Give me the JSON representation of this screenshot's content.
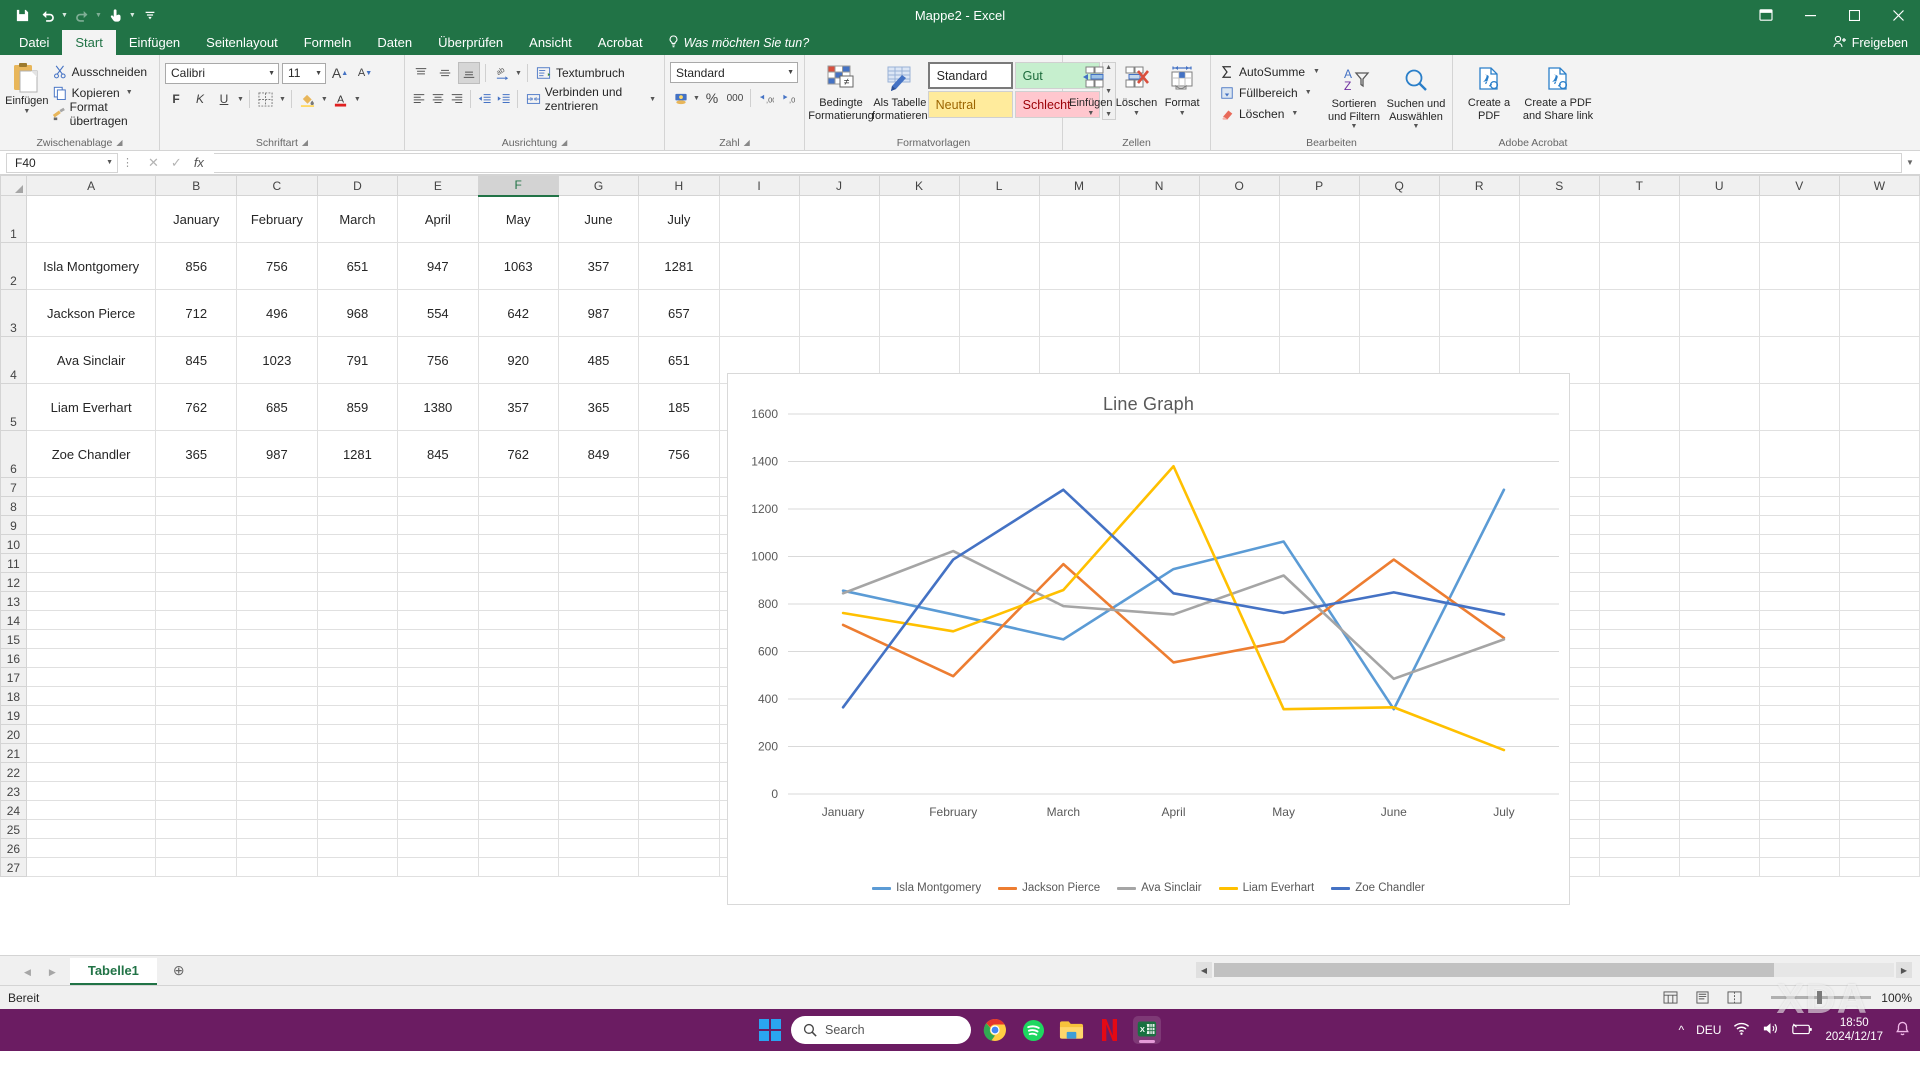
{
  "titlebar": {
    "title": "Mappe2 - Excel",
    "qat": [
      {
        "name": "save-icon",
        "glyph": "ὋE"
      },
      {
        "name": "undo-icon",
        "glyph": "↶"
      },
      {
        "name": "redo-icon",
        "glyph": "↷"
      },
      {
        "name": "touch-mode-icon",
        "glyph": "☝"
      },
      {
        "name": "customize-qat-icon",
        "glyph": "≡"
      }
    ],
    "window_controls": {
      "minimize": "–",
      "restore": "☐",
      "close": "✕",
      "ribbon_options": "⤡"
    }
  },
  "ribbon": {
    "tabs": [
      {
        "label": "Datei",
        "active": false
      },
      {
        "label": "Start",
        "active": true
      },
      {
        "label": "Einfügen",
        "active": false
      },
      {
        "label": "Seitenlayout",
        "active": false
      },
      {
        "label": "Formeln",
        "active": false
      },
      {
        "label": "Daten",
        "active": false
      },
      {
        "label": "Überprüfen",
        "active": false
      },
      {
        "label": "Ansicht",
        "active": false
      },
      {
        "label": "Acrobat",
        "active": false
      }
    ],
    "tell_me": "Was möchten Sie tun?",
    "share_label": "Freigeben",
    "groups": {
      "clipboard": {
        "label": "Zwischenablage",
        "paste": "Einfügen",
        "cut": "Ausschneiden",
        "copy": "Kopieren",
        "format_painter": "Format übertragen"
      },
      "font": {
        "label": "Schriftart",
        "font_name": "Calibri",
        "font_size": "11",
        "bold": "F",
        "italic": "K",
        "underline": "U",
        "grow_font": "A",
        "shrink_font": "A"
      },
      "alignment": {
        "label": "Ausrichtung",
        "wrap_text": "Textumbruch",
        "merge_center": "Verbinden und zentrieren"
      },
      "number": {
        "label": "Zahl",
        "format": "Standard",
        "percent": "%",
        "thousands": "000"
      },
      "styles": {
        "label": "Formatvorlagen",
        "conditional_formatting": "Bedingte Formatierung",
        "format_as_table": "Als Tabelle formatieren",
        "cells": [
          "Standard",
          "Gut",
          "Neutral",
          "Schlecht"
        ]
      },
      "cells": {
        "label": "Zellen",
        "insert": "Einfügen",
        "delete": "Löschen",
        "format": "Format"
      },
      "editing": {
        "label": "Bearbeiten",
        "autosum": "AutoSumme",
        "fill": "Füllbereich",
        "clear": "Löschen",
        "sort_filter": "Sortieren und Filtern",
        "find_select": "Suchen und Auswählen"
      },
      "acrobat": {
        "label": "Adobe Acrobat",
        "create_pdf": "Create a PDF",
        "create_share": "Create a PDF and Share link"
      }
    }
  },
  "formula_bar": {
    "name_box": "F40",
    "cancel": "✕",
    "enter": "✓",
    "fx": "fx",
    "value": ""
  },
  "grid": {
    "column_headers": [
      "A",
      "B",
      "C",
      "D",
      "E",
      "F",
      "G",
      "H",
      "I",
      "J",
      "K",
      "L",
      "M",
      "N",
      "O",
      "P",
      "Q",
      "R",
      "S",
      "T",
      "U",
      "V",
      "W"
    ],
    "selected_column": "F",
    "row_numbers": [
      "1",
      "2",
      "3",
      "4",
      "5",
      "6",
      "7",
      "8",
      "9",
      "10",
      "11",
      "12",
      "13",
      "14",
      "15",
      "16",
      "17",
      "18",
      "19",
      "20",
      "21",
      "22",
      "23",
      "24",
      "25",
      "26",
      "27"
    ],
    "data_rows": [
      [
        "",
        "January",
        "February",
        "March",
        "April",
        "May",
        "June",
        "July"
      ],
      [
        "Isla Montgomery",
        "856",
        "756",
        "651",
        "947",
        "1063",
        "357",
        "1281"
      ],
      [
        "Jackson Pierce",
        "712",
        "496",
        "968",
        "554",
        "642",
        "987",
        "657"
      ],
      [
        "Ava Sinclair",
        "845",
        "1023",
        "791",
        "756",
        "920",
        "485",
        "651"
      ],
      [
        "Liam Everhart",
        "762",
        "685",
        "859",
        "1380",
        "357",
        "365",
        "185"
      ],
      [
        "Zoe Chandler",
        "365",
        "987",
        "1281",
        "845",
        "762",
        "849",
        "756"
      ]
    ]
  },
  "chart_data": {
    "type": "line",
    "title": "Line Graph",
    "xlabel": "",
    "ylabel": "",
    "categories": [
      "January",
      "February",
      "March",
      "April",
      "May",
      "June",
      "July"
    ],
    "ylim": [
      0,
      1600
    ],
    "yticks": [
      0,
      200,
      400,
      600,
      800,
      1000,
      1200,
      1400,
      1600
    ],
    "grid": true,
    "legend_position": "bottom",
    "series": [
      {
        "name": "Isla Montgomery",
        "color": "#5b9bd5",
        "values": [
          856,
          756,
          651,
          947,
          1063,
          357,
          1281
        ]
      },
      {
        "name": "Jackson Pierce",
        "color": "#ed7d31",
        "values": [
          712,
          496,
          968,
          554,
          642,
          987,
          657
        ]
      },
      {
        "name": "Ava Sinclair",
        "color": "#a5a5a5",
        "values": [
          845,
          1023,
          791,
          756,
          920,
          485,
          651
        ]
      },
      {
        "name": "Liam Everhart",
        "color": "#ffc000",
        "values": [
          762,
          685,
          859,
          1380,
          357,
          365,
          185
        ]
      },
      {
        "name": "Zoe Chandler",
        "color": "#4472c4",
        "values": [
          365,
          987,
          1281,
          845,
          762,
          849,
          756
        ]
      }
    ]
  },
  "sheet_bar": {
    "prev": "◀",
    "next": "▶",
    "tabs": [
      "Tabelle1"
    ],
    "add_sheet": "⊕"
  },
  "status_bar": {
    "status": "Bereit",
    "zoom": "100%",
    "views": [
      "normal-view",
      "page-layout-view",
      "page-break-view"
    ]
  },
  "taskbar": {
    "search_placeholder": "Search",
    "apps": [
      "chrome-icon",
      "spotify-icon",
      "file-explorer-icon",
      "netflix-icon",
      "excel-icon"
    ],
    "language": "DEU",
    "time": "18:50",
    "date": "2024/12/17",
    "watermark": "XDA"
  }
}
